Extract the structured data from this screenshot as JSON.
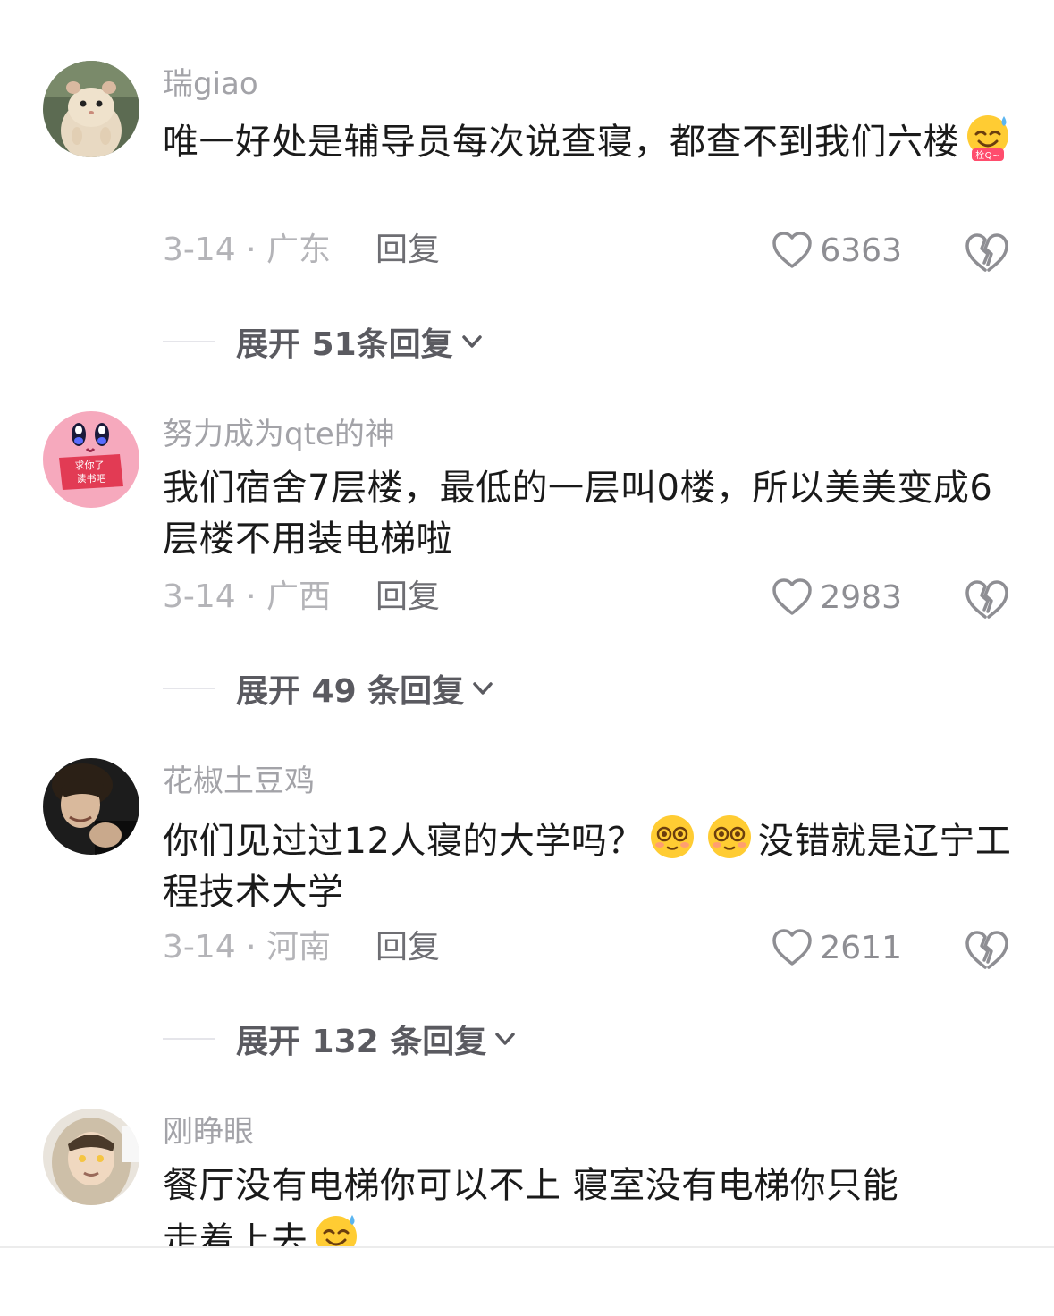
{
  "comments": [
    {
      "username": "瑞giao",
      "text_before": "唯一好处是辅导员每次说查寝，都查不到我们六楼",
      "emoji": "sweat-smile-emoji",
      "emoji_caption": "栓Q~",
      "date_location": "3-14 · 广东",
      "reply": "回复",
      "likes": "6363",
      "expand": "展开 51条回复"
    },
    {
      "username": "努力成为qte的神",
      "text_before": "我们宿舍7层楼，最低的一层叫0楼，所以美美变成6层楼不用装电梯啦",
      "avatar_text_1": "求你了",
      "avatar_text_2": "读书吧",
      "date_location": "3-14 · 广西",
      "reply": "回复",
      "likes": "2983",
      "expand": "展开 49 条回复"
    },
    {
      "username": "花椒土豆鸡",
      "text_before": "你们见过过12人寝的大学吗？",
      "text_after": "没错就是辽宁工程技术大学",
      "emoji": "dizzy-face-emoji",
      "date_location": "3-14 · 河南",
      "reply": "回复",
      "likes": "2611",
      "expand": "展开 132 条回复"
    },
    {
      "username": "刚睁眼",
      "text_line1": "餐厅没有电梯你可以不上 寝室没有电梯你只能",
      "text_line2": "走着上去",
      "emoji": "sweat-smile-emoji"
    }
  ],
  "colors": {
    "username": "#a3a3a8",
    "text": "#1a1a1a",
    "meta": "#b4b4b8",
    "expand": "#5a5a60"
  }
}
